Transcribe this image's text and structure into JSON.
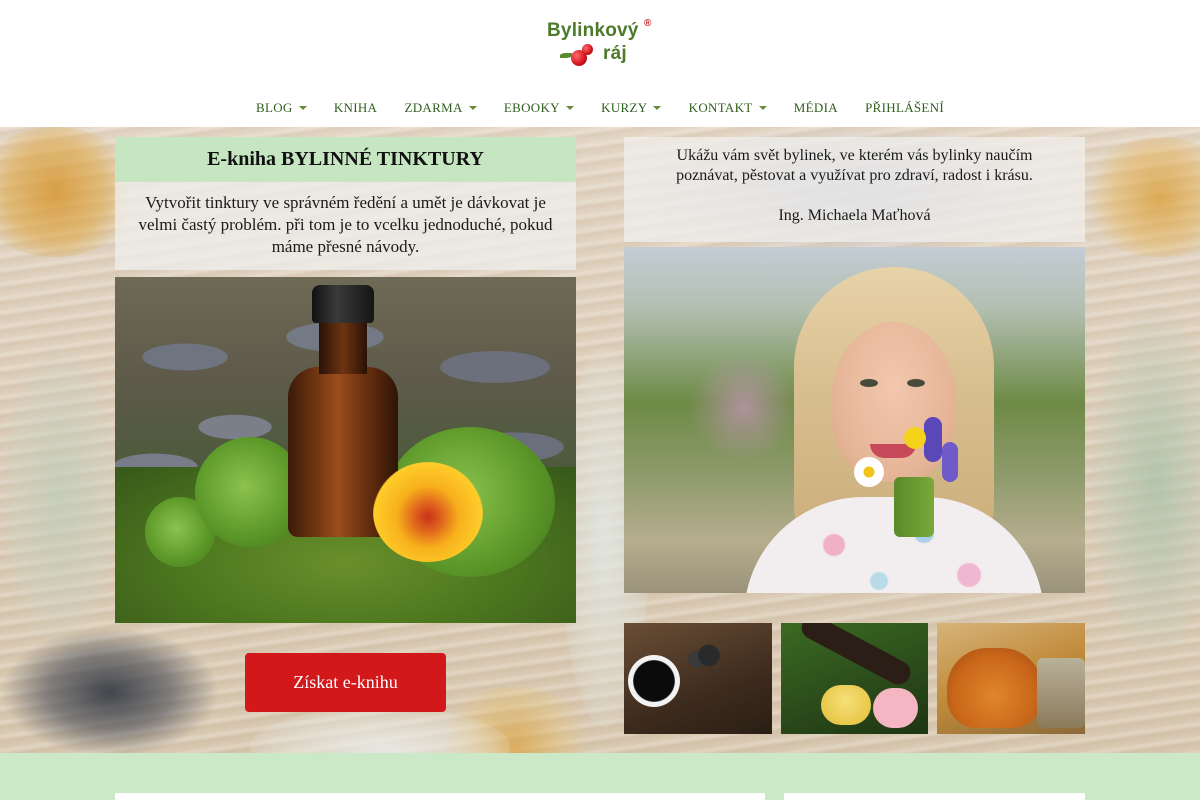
{
  "brand": {
    "logo_line1": "Bylinkový",
    "logo_line2": "ráj",
    "registered_mark": "®",
    "primary_color": "#4d7a2a",
    "accent_color": "#c2262e"
  },
  "nav": {
    "items": [
      {
        "label": "BLOG",
        "has_dropdown": true
      },
      {
        "label": "KNIHA",
        "has_dropdown": false
      },
      {
        "label": "ZDARMA",
        "has_dropdown": true
      },
      {
        "label": "EBOOKY",
        "has_dropdown": true
      },
      {
        "label": "KURZY",
        "has_dropdown": true
      },
      {
        "label": "KONTAKT",
        "has_dropdown": true
      },
      {
        "label": "MÉDIA",
        "has_dropdown": false
      },
      {
        "label": "PŘIHLÁŠENÍ",
        "has_dropdown": false
      }
    ],
    "text_color": "#2f5f1e"
  },
  "hero": {
    "ebook": {
      "title": "E-kniha BYLINNÉ TINKTURY",
      "description": "Vytvořit tinktury ve správném ředění a umět je dávkovat je velmi častý problém. při tom je to vcelku jednoduché, pokud máme přesné návody.",
      "cta_label": "Získat e-knihu",
      "cta_color": "#d3181c",
      "title_box_color": "#c6e6c2"
    },
    "intro": {
      "text": "Ukážu vám svět bylinek, ve kterém vás bylinky naučím poznávat, pěstovat a využívat pro zdraví, radost i krásu.",
      "author": "Ing. Michaela Maťhová"
    }
  },
  "footer_band": {
    "color": "#cbe9c7"
  }
}
